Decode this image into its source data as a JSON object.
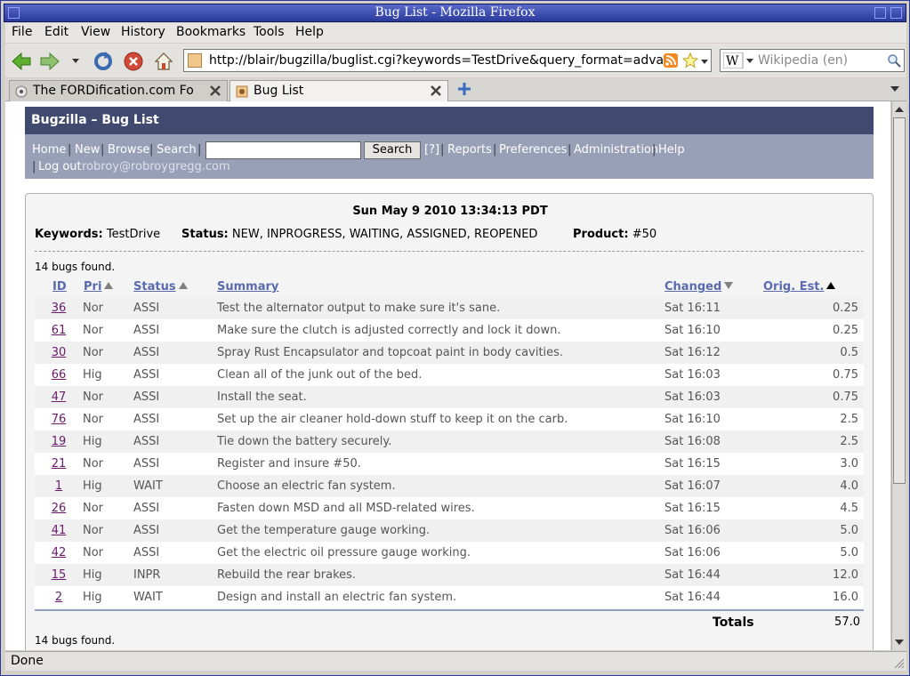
{
  "window": {
    "title": "Bug List - Mozilla Firefox"
  },
  "menu": [
    "File",
    "Edit",
    "View",
    "History",
    "Bookmarks",
    "Tools",
    "Help"
  ],
  "navbar": {
    "url": "http://blair/bugzilla/buglist.cgi?keywords=TestDrive&query_format=advanced",
    "search_placeholder": "Wikipedia (en)"
  },
  "tabs": [
    {
      "title": "The FORDification.com For..."
    },
    {
      "title": "Bug List"
    }
  ],
  "bugzilla": {
    "header": "Bugzilla – Bug List",
    "links": [
      "Home",
      "New",
      "Browse",
      "Search"
    ],
    "search_button": "Search",
    "help_link": "[?]",
    "links2": [
      "Reports",
      "Preferences",
      "Administration",
      "Help"
    ],
    "logout": "Log out",
    "user_email": "robroy@robroygregg.com"
  },
  "report": {
    "timestamp": "Sun May 9 2010 13:34:13 PDT",
    "keywords_label": "Keywords:",
    "keywords_value": "TestDrive",
    "status_label": "Status:",
    "status_value": "NEW, INPROGRESS, WAITING, ASSIGNED, REOPENED",
    "product_label": "Product:",
    "product_value": "#50",
    "count_text": "14 bugs found.",
    "columns": {
      "id": "ID",
      "pri": "Pri",
      "status": "Status",
      "summary": "Summary",
      "changed": "Changed",
      "est": "Orig. Est."
    },
    "rows": [
      {
        "id": "36",
        "pri": "Nor",
        "status": "ASSI",
        "summary": "Test the alternator output to make sure it's sane.",
        "changed": "Sat 16:11",
        "est": "0.25"
      },
      {
        "id": "61",
        "pri": "Nor",
        "status": "ASSI",
        "summary": "Make sure the clutch is adjusted correctly and lock it down.",
        "changed": "Sat 16:10",
        "est": "0.25"
      },
      {
        "id": "30",
        "pri": "Nor",
        "status": "ASSI",
        "summary": "Spray Rust Encapsulator and topcoat paint in body cavities.",
        "changed": "Sat 16:12",
        "est": "0.5"
      },
      {
        "id": "66",
        "pri": "Hig",
        "status": "ASSI",
        "summary": "Clean all of the junk out of the bed.",
        "changed": "Sat 16:03",
        "est": "0.75"
      },
      {
        "id": "47",
        "pri": "Nor",
        "status": "ASSI",
        "summary": "Install the seat.",
        "changed": "Sat 16:03",
        "est": "0.75"
      },
      {
        "id": "76",
        "pri": "Nor",
        "status": "ASSI",
        "summary": "Set up the air cleaner hold-down stuff to keep it on the carb.",
        "changed": "Sat 16:10",
        "est": "2.5"
      },
      {
        "id": "19",
        "pri": "Hig",
        "status": "ASSI",
        "summary": "Tie down the battery securely.",
        "changed": "Sat 16:08",
        "est": "2.5"
      },
      {
        "id": "21",
        "pri": "Nor",
        "status": "ASSI",
        "summary": "Register and insure #50.",
        "changed": "Sat 16:15",
        "est": "3.0"
      },
      {
        "id": "1",
        "pri": "Hig",
        "status": "WAIT",
        "summary": "Choose an electric fan system.",
        "changed": "Sat 16:07",
        "est": "4.0"
      },
      {
        "id": "26",
        "pri": "Nor",
        "status": "ASSI",
        "summary": "Fasten down MSD and all MSD-related wires.",
        "changed": "Sat 16:15",
        "est": "4.5"
      },
      {
        "id": "41",
        "pri": "Nor",
        "status": "ASSI",
        "summary": "Get the temperature gauge working.",
        "changed": "Sat 16:06",
        "est": "5.0"
      },
      {
        "id": "42",
        "pri": "Nor",
        "status": "ASSI",
        "summary": "Get the electric oil pressure gauge working.",
        "changed": "Sat 16:06",
        "est": "5.0"
      },
      {
        "id": "15",
        "pri": "Hig",
        "status": "INPR",
        "summary": "Rebuild the rear brakes.",
        "changed": "Sat 16:44",
        "est": "12.0"
      },
      {
        "id": "2",
        "pri": "Hig",
        "status": "WAIT",
        "summary": "Design and install an electric fan system.",
        "changed": "Sat 16:44",
        "est": "16.0"
      }
    ],
    "totals_label": "Totals",
    "totals_value": "57.0"
  },
  "statusbar": {
    "text": "Done"
  }
}
